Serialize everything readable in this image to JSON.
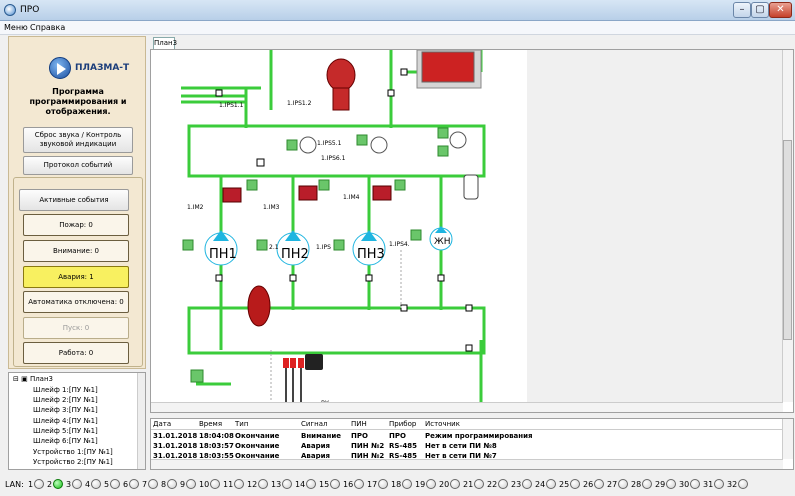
{
  "window": {
    "title": "ПРО",
    "min": "–",
    "max": "▢",
    "close": "✕"
  },
  "menu": [
    "Меню",
    "Справка"
  ],
  "logo": {
    "text": "ПЛАЗМА-Т"
  },
  "left": {
    "subtitle": "Программа программирования и отображения.",
    "sound_button": "Сброс звука / Контроль звуковой индикации",
    "protocol_button": "Протокол событий",
    "active_events": "Активные события",
    "counters": [
      {
        "label": "Пожар: 0"
      },
      {
        "label": "Внимание: 0"
      },
      {
        "label": "Авария: 1"
      },
      {
        "label": "Автоматика отключена: 0"
      },
      {
        "label": "Пуск: 0"
      },
      {
        "label": "Работа: 0"
      }
    ]
  },
  "tree": {
    "root": "План3",
    "items": [
      "Шлейф 1:[ПУ №1]",
      "Шлейф 2:[ПУ №1]",
      "Шлейф 3:[ПУ №1]",
      "Шлейф 4:[ПУ №1]",
      "Шлейф 5:[ПУ №1]",
      "Шлейф 6:[ПУ №1]",
      "Устройство 1:[ПУ №1]",
      "Устройство 2:[ПУ №1]"
    ]
  },
  "tab": {
    "label": "План3"
  },
  "diagram": {
    "labels": {
      "ips11": "1.IPS1.1",
      "ips12": "1.IPS1.2",
      "ips51": "1.IPS5.1",
      "ips61": "1.IPS6.1",
      "im2": "1.IM2",
      "im3": "1.IM3",
      "im4": "1.IM4",
      "ips2": "2.1",
      "ips3": "1.IPS",
      "ips4": "1.IPS4.",
      "pn1": "ПН1",
      "pn2": "ПН2",
      "pn3": "ПН3",
      "zhn": "ЖН",
      "vu": "ВУ"
    }
  },
  "events": {
    "headers": [
      "Дата",
      "Время",
      "Тип",
      "Сигнал",
      "ПИН",
      "Прибор",
      "Источник"
    ],
    "rows": [
      [
        "31.01.2018",
        "18:04:08",
        "Окончание",
        "Внимание",
        "ПРО",
        "ПРО",
        "Режим программирования"
      ],
      [
        "31.01.2018",
        "18:03:57",
        "Окончание",
        "Авария",
        "ПИН №2",
        "RS-485",
        "Нет в сети ПИ №8"
      ],
      [
        "31.01.2018",
        "18:03:55",
        "Окончание",
        "Авария",
        "ПИН №2",
        "RS-485",
        "Нет в сети ПИ №7"
      ]
    ]
  },
  "lan": {
    "label": "LAN:",
    "numbers": [
      "1",
      "2",
      "3",
      "4",
      "5",
      "6",
      "7",
      "8",
      "9",
      "10",
      "11",
      "12",
      "13",
      "14",
      "15",
      "16",
      "17",
      "18",
      "19",
      "20",
      "21",
      "22",
      "23",
      "24",
      "25",
      "26",
      "27",
      "28",
      "29",
      "30",
      "31",
      "32"
    ],
    "active": [
      2
    ]
  },
  "colors": {
    "pipe": "#3bcc3b",
    "pump": "#1fb5e0",
    "alarm": "#f8f060",
    "lan_on": "#16c016"
  }
}
